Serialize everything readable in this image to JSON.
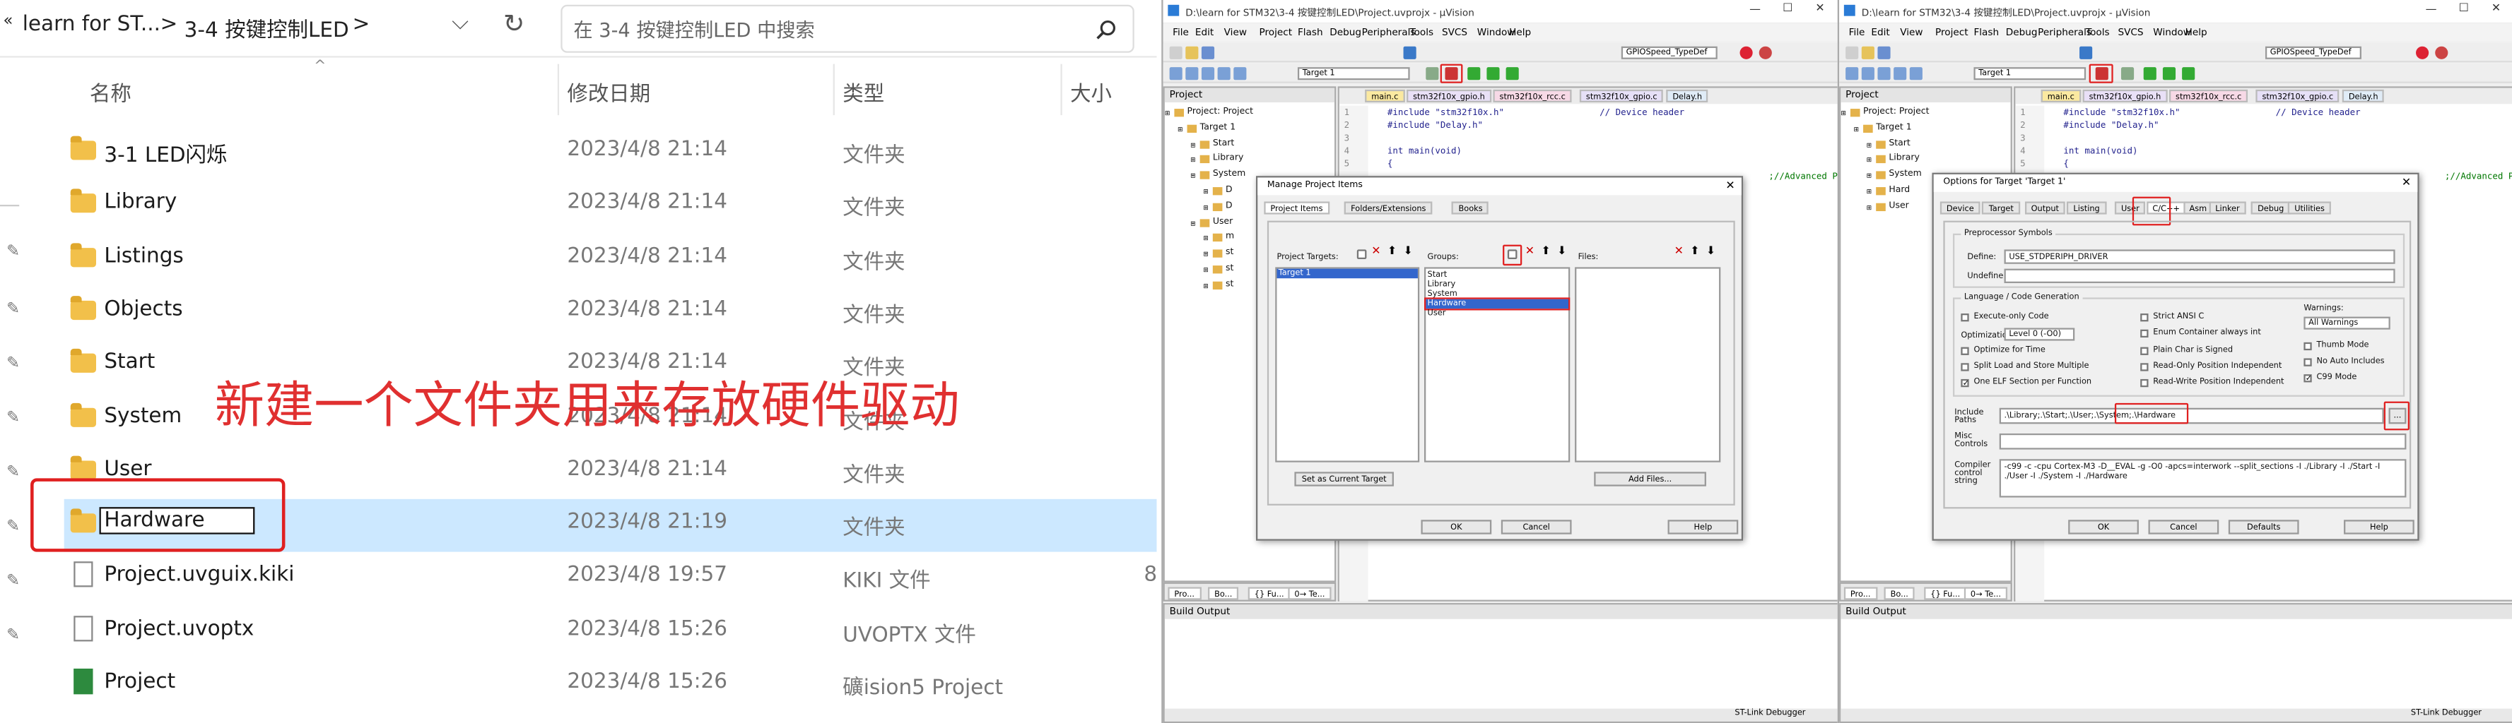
{
  "explorer": {
    "breadcrumb": {
      "back": "«",
      "folder1": "learn for ST...",
      "sep1": ">",
      "folder2": "3-4 按键控制LED",
      "sep2": ">"
    },
    "search_placeholder": "在 3-4 按键控制LED 中搜索",
    "columns": {
      "name": "名称",
      "date": "修改日期",
      "type": "类型",
      "size": "大小"
    },
    "rows": [
      {
        "name": "3-1 LED闪烁",
        "date": "2023/4/8 21:14",
        "type": "文件夹",
        "kind": "folder"
      },
      {
        "name": "Library",
        "date": "2023/4/8 21:14",
        "type": "文件夹",
        "kind": "folder"
      },
      {
        "name": "Listings",
        "date": "2023/4/8 21:14",
        "type": "文件夹",
        "kind": "folder"
      },
      {
        "name": "Objects",
        "date": "2023/4/8 21:14",
        "type": "文件夹",
        "kind": "folder"
      },
      {
        "name": "Start",
        "date": "2023/4/8 21:14",
        "type": "文件夹",
        "kind": "folder"
      },
      {
        "name": "System",
        "date": "2023/4/8 21:14",
        "type": "文件夹",
        "kind": "folder"
      },
      {
        "name": "User",
        "date": "2023/4/8 21:14",
        "type": "文件夹",
        "kind": "folder"
      },
      {
        "name": "Hardware",
        "date": "2023/4/8 21:19",
        "type": "文件夹",
        "kind": "folder",
        "selected": true
      },
      {
        "name": "Project.uvguix.kiki",
        "date": "2023/4/8 19:57",
        "type": "KIKI 文件",
        "size": "8",
        "kind": "file"
      },
      {
        "name": "Project.uvoptx",
        "date": "2023/4/8 15:26",
        "type": "UVOPTX 文件",
        "kind": "file"
      },
      {
        "name": "Project",
        "date": "2023/4/8 15:26",
        "type": "礦ision5 Project",
        "kind": "project"
      }
    ],
    "annotation": "新建一个文件夹用来存放硬件驱动",
    "colors": {
      "annotation": "#e03030",
      "selected_row": "#cce8ff",
      "highlight_box": "#e02020"
    }
  },
  "uv1": {
    "title": "D:\\learn for STM32\\3-4 按键控制LED\\Project.uvprojx - µVision",
    "menu": [
      "File",
      "Edit",
      "View",
      "Project",
      "Flash",
      "Debug",
      "Peripherals",
      "Tools",
      "SVCS",
      "Window",
      "Help"
    ],
    "toolbar_combo": "GPIOSpeed_TypeDef",
    "target_combo": "Target 1",
    "project_pane": "Project",
    "tree": [
      "Project: Project",
      "Target 1",
      "Start",
      "Library",
      "System",
      "D",
      "D",
      "User",
      "m",
      "st",
      "st",
      "st"
    ],
    "tabs": [
      "main.c",
      "stm32f10x_gpio.h",
      "stm32f10x_rcc.c",
      "stm32f10x_gpio.c",
      "Delay.h"
    ],
    "code": [
      {
        "n": "1",
        "t": "#include \"stm32f10x.h\"                  // Device header"
      },
      {
        "n": "2",
        "t": "#include \"Delay.h\""
      },
      {
        "n": "3",
        "t": ""
      },
      {
        "n": "4",
        "t": "int main(void)"
      },
      {
        "n": "5",
        "t": "{"
      }
    ],
    "code_tail": ";//Advanced P",
    "bottom_tabs": [
      "Pro...",
      "Bo...",
      "{} Fu...",
      "0→ Te..."
    ],
    "build_output": "Build Output",
    "status": "ST-Link Debugger",
    "dialog": {
      "title": "Manage Project Items",
      "tabs": [
        "Project Items",
        "Folders/Extensions",
        "Books"
      ],
      "targets_label": "Project Targets:",
      "groups_label": "Groups:",
      "files_label": "Files:",
      "targets": [
        "Target 1"
      ],
      "groups": [
        "Start",
        "Library",
        "System",
        "Hardware",
        "User"
      ],
      "set_current": "Set as Current Target",
      "add_files": "Add Files...",
      "ok": "OK",
      "cancel": "Cancel",
      "help": "Help"
    }
  },
  "uv2": {
    "title": "D:\\learn for STM32\\3-4 按键控制LED\\Project.uvprojx - µVision",
    "menu": [
      "File",
      "Edit",
      "View",
      "Project",
      "Flash",
      "Debug",
      "Peripherals",
      "Tools",
      "SVCS",
      "Window",
      "Help"
    ],
    "toolbar_combo": "GPIOSpeed_TypeDef",
    "target_combo": "Target 1",
    "project_pane": "Project",
    "tree": [
      "Project: Project",
      "Target 1",
      "Start",
      "Library",
      "System",
      "Hard",
      "User"
    ],
    "tabs": [
      "main.c",
      "stm32f10x_gpio.h",
      "stm32f10x_rcc.c",
      "stm32f10x_gpio.c",
      "Delay.h"
    ],
    "code": [
      {
        "n": "1",
        "t": "#include \"stm32f10x.h\"                  // Device header"
      },
      {
        "n": "2",
        "t": "#include \"Delay.h\""
      },
      {
        "n": "3",
        "t": ""
      },
      {
        "n": "4",
        "t": "int main(void)"
      },
      {
        "n": "5",
        "t": "{"
      }
    ],
    "code_tail": ";//Advanced P",
    "bottom_tabs": [
      "Pro...",
      "Bo...",
      "{} Fu...",
      "0→ Te..."
    ],
    "build_output": "Build Output",
    "status": "ST-Link Debugger",
    "dialog": {
      "title": "Options for Target 'Target 1'",
      "tabs": [
        "Device",
        "Target",
        "Output",
        "Listing",
        "User",
        "C/C++",
        "Asm",
        "Linker",
        "Debug",
        "Utilities"
      ],
      "pre_group": "Preprocessor Symbols",
      "define_label": "Define:",
      "define_value": "USE_STDPERIPH_DRIVER",
      "undefine_label": "Undefine:",
      "lang_group": "Language / Code Generation",
      "opts_left": [
        "Execute-only Code",
        "Optimize for Time",
        "Split Load and Store Multiple",
        "One ELF Section per Function"
      ],
      "opts_left_checked": [
        false,
        false,
        false,
        true
      ],
      "optimization_label": "Optimization:",
      "optimization_value": "Level 0 (-O0)",
      "opts_mid": [
        "Strict ANSI C",
        "Enum Container always int",
        "Plain Char is Signed",
        "Read-Only Position Independent",
        "Read-Write Position Independent"
      ],
      "warnings_label": "Warnings:",
      "warnings_value": "All Warnings",
      "opts_right": [
        "Thumb Mode",
        "No Auto Includes",
        "C99 Mode"
      ],
      "opts_right_checked": [
        false,
        false,
        true
      ],
      "include_label": "Include\nPaths",
      "include_value": ".\\Library;.\\Start;.\\User;.\\System;.\\Hardware",
      "misc_label": "Misc\nControls",
      "compiler_label": "Compiler\ncontrol\nstring",
      "compiler_value": "-c99 -c -cpu Cortex-M3 -D__EVAL -g -O0 -apcs=interwork --split_sections -I ./Library -I ./Start -I ./User -I ./System -I ./Hardware",
      "ok": "OK",
      "cancel": "Cancel",
      "defaults": "Defaults",
      "help": "Help"
    }
  }
}
